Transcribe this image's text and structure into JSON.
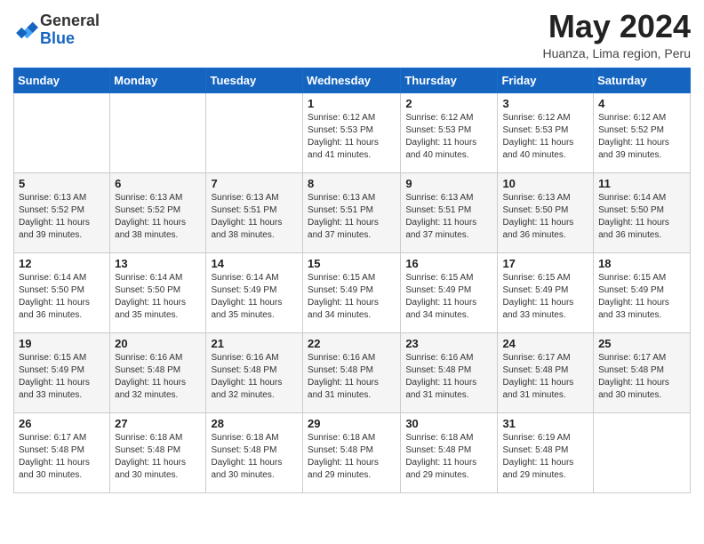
{
  "header": {
    "logo_line1": "General",
    "logo_line2": "Blue",
    "month": "May 2024",
    "location": "Huanza, Lima region, Peru"
  },
  "days_of_week": [
    "Sunday",
    "Monday",
    "Tuesday",
    "Wednesday",
    "Thursday",
    "Friday",
    "Saturday"
  ],
  "weeks": [
    [
      {
        "day": "",
        "info": ""
      },
      {
        "day": "",
        "info": ""
      },
      {
        "day": "",
        "info": ""
      },
      {
        "day": "1",
        "info": "Sunrise: 6:12 AM\nSunset: 5:53 PM\nDaylight: 11 hours and 41 minutes."
      },
      {
        "day": "2",
        "info": "Sunrise: 6:12 AM\nSunset: 5:53 PM\nDaylight: 11 hours and 40 minutes."
      },
      {
        "day": "3",
        "info": "Sunrise: 6:12 AM\nSunset: 5:53 PM\nDaylight: 11 hours and 40 minutes."
      },
      {
        "day": "4",
        "info": "Sunrise: 6:12 AM\nSunset: 5:52 PM\nDaylight: 11 hours and 39 minutes."
      }
    ],
    [
      {
        "day": "5",
        "info": "Sunrise: 6:13 AM\nSunset: 5:52 PM\nDaylight: 11 hours and 39 minutes."
      },
      {
        "day": "6",
        "info": "Sunrise: 6:13 AM\nSunset: 5:52 PM\nDaylight: 11 hours and 38 minutes."
      },
      {
        "day": "7",
        "info": "Sunrise: 6:13 AM\nSunset: 5:51 PM\nDaylight: 11 hours and 38 minutes."
      },
      {
        "day": "8",
        "info": "Sunrise: 6:13 AM\nSunset: 5:51 PM\nDaylight: 11 hours and 37 minutes."
      },
      {
        "day": "9",
        "info": "Sunrise: 6:13 AM\nSunset: 5:51 PM\nDaylight: 11 hours and 37 minutes."
      },
      {
        "day": "10",
        "info": "Sunrise: 6:13 AM\nSunset: 5:50 PM\nDaylight: 11 hours and 36 minutes."
      },
      {
        "day": "11",
        "info": "Sunrise: 6:14 AM\nSunset: 5:50 PM\nDaylight: 11 hours and 36 minutes."
      }
    ],
    [
      {
        "day": "12",
        "info": "Sunrise: 6:14 AM\nSunset: 5:50 PM\nDaylight: 11 hours and 36 minutes."
      },
      {
        "day": "13",
        "info": "Sunrise: 6:14 AM\nSunset: 5:50 PM\nDaylight: 11 hours and 35 minutes."
      },
      {
        "day": "14",
        "info": "Sunrise: 6:14 AM\nSunset: 5:49 PM\nDaylight: 11 hours and 35 minutes."
      },
      {
        "day": "15",
        "info": "Sunrise: 6:15 AM\nSunset: 5:49 PM\nDaylight: 11 hours and 34 minutes."
      },
      {
        "day": "16",
        "info": "Sunrise: 6:15 AM\nSunset: 5:49 PM\nDaylight: 11 hours and 34 minutes."
      },
      {
        "day": "17",
        "info": "Sunrise: 6:15 AM\nSunset: 5:49 PM\nDaylight: 11 hours and 33 minutes."
      },
      {
        "day": "18",
        "info": "Sunrise: 6:15 AM\nSunset: 5:49 PM\nDaylight: 11 hours and 33 minutes."
      }
    ],
    [
      {
        "day": "19",
        "info": "Sunrise: 6:15 AM\nSunset: 5:49 PM\nDaylight: 11 hours and 33 minutes."
      },
      {
        "day": "20",
        "info": "Sunrise: 6:16 AM\nSunset: 5:48 PM\nDaylight: 11 hours and 32 minutes."
      },
      {
        "day": "21",
        "info": "Sunrise: 6:16 AM\nSunset: 5:48 PM\nDaylight: 11 hours and 32 minutes."
      },
      {
        "day": "22",
        "info": "Sunrise: 6:16 AM\nSunset: 5:48 PM\nDaylight: 11 hours and 31 minutes."
      },
      {
        "day": "23",
        "info": "Sunrise: 6:16 AM\nSunset: 5:48 PM\nDaylight: 11 hours and 31 minutes."
      },
      {
        "day": "24",
        "info": "Sunrise: 6:17 AM\nSunset: 5:48 PM\nDaylight: 11 hours and 31 minutes."
      },
      {
        "day": "25",
        "info": "Sunrise: 6:17 AM\nSunset: 5:48 PM\nDaylight: 11 hours and 30 minutes."
      }
    ],
    [
      {
        "day": "26",
        "info": "Sunrise: 6:17 AM\nSunset: 5:48 PM\nDaylight: 11 hours and 30 minutes."
      },
      {
        "day": "27",
        "info": "Sunrise: 6:18 AM\nSunset: 5:48 PM\nDaylight: 11 hours and 30 minutes."
      },
      {
        "day": "28",
        "info": "Sunrise: 6:18 AM\nSunset: 5:48 PM\nDaylight: 11 hours and 30 minutes."
      },
      {
        "day": "29",
        "info": "Sunrise: 6:18 AM\nSunset: 5:48 PM\nDaylight: 11 hours and 29 minutes."
      },
      {
        "day": "30",
        "info": "Sunrise: 6:18 AM\nSunset: 5:48 PM\nDaylight: 11 hours and 29 minutes."
      },
      {
        "day": "31",
        "info": "Sunrise: 6:19 AM\nSunset: 5:48 PM\nDaylight: 11 hours and 29 minutes."
      },
      {
        "day": "",
        "info": ""
      }
    ]
  ]
}
